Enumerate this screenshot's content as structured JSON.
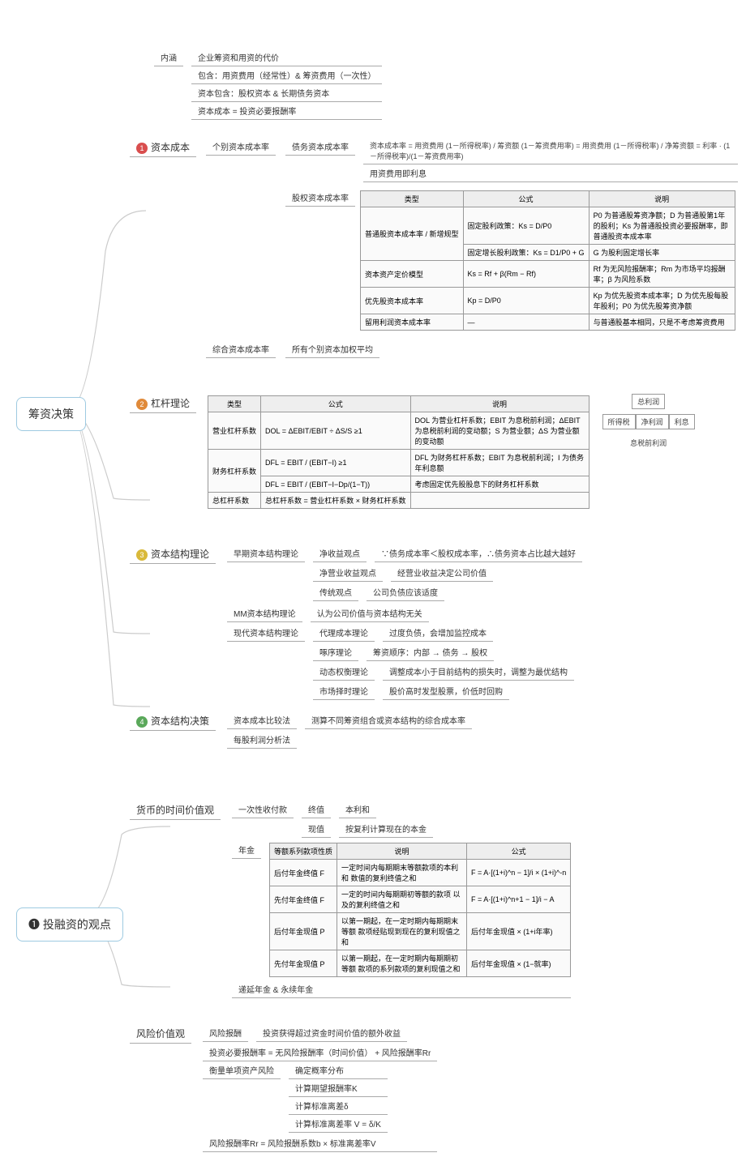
{
  "roots": {
    "r1": "筹资决策",
    "r2": "❶ 投融资的观点"
  },
  "s1": {
    "title": "资本成本",
    "conn": {
      "label": "内涵",
      "items": [
        "企业筹资和用资的代价",
        "包含：用资费用（经常性）& 筹资费用（一次性）",
        "资本包含：股权资本 & 长期债务资本",
        "资本成本 = 投资必要报酬率"
      ]
    },
    "indiv": {
      "label": "个别资本成本率",
      "debt": {
        "label": "债务资本成本率",
        "formula": "资本成本率 = 用资费用 (1－所得税率) / 筹资额 (1－筹资费用率) = 用资费用 (1－所得税率) / 净筹资额 = 利率 · (1－所得税率)/(1－筹资费用率)",
        "note": "用资费用即利息"
      },
      "equity": {
        "label": "股权资本成本率",
        "tbl": {
          "h": [
            "类型",
            "公式",
            "说明"
          ],
          "r": [
            [
              "普通股资本成本率 / 新增规型",
              "固定股利政策：Ks = D/P0",
              "P0 为普通股筹资净额；D 为普通股第1年的股利；Ks 为普通股投资必要报酬率，即普通股资本成本率"
            ],
            [
              "",
              "固定增长股利政策：Ks = D1/P0 + G",
              "G 为股利固定增长率"
            ],
            [
              "资本资产定价模型",
              "Ks = Rf + β(Rm − Rf)",
              "Rf 为无风险报酬率；Rm 为市场平均报酬率；β 为风险系数"
            ],
            [
              "优先股资本成本率",
              "Kp = D/P0",
              "Kp 为优先股资本成本率；D 为优先股每股年股利；P0 为优先股筹资净额"
            ],
            [
              "留用利润资本成本率",
              "—",
              "与普通股基本相同，只是不考虑筹资费用"
            ]
          ]
        }
      }
    },
    "comp": {
      "label": "综合资本成本率",
      "text": "所有个别资本加权平均"
    }
  },
  "s2": {
    "title": "杠杆理论",
    "tbl": {
      "h": [
        "类型",
        "公式",
        "说明"
      ],
      "r": [
        [
          "营业杠杆系数",
          "DOL = ΔEBIT/EBIT ÷ ΔS/S  ≥1",
          "DOL 为营业杠杆系数；EBIT 为息税前利润；ΔEBIT 为息税前利润的变动额；S 为营业额；ΔS 为营业额的变动额"
        ],
        [
          "财务杠杆系数",
          "DFL = EBIT / (EBIT−I)  ≥1",
          "DFL 为财务杠杆系数；EBIT 为息税前利润；I 为债务年利息额"
        ],
        [
          "",
          "DFL = EBIT / (EBIT−I−Dp/(1−T))",
          "考虑固定优先股股息下的财务杠杆系数"
        ],
        [
          "总杠杆系数",
          "总杠杆系数 = 营业杠杆系数 × 财务杠杆系数",
          ""
        ]
      ]
    },
    "side": {
      "top": "总利润",
      "row": [
        "所得税",
        "净利润",
        "利息"
      ],
      "bottom": "息税前利润"
    }
  },
  "s3": {
    "title": "资本结构理论",
    "early": {
      "label": "早期资本结构理论",
      "items": [
        {
          "k": "净收益观点",
          "v": "∵债务成本率＜股权成本率，∴债务资本占比越大越好"
        },
        {
          "k": "净营业收益观点",
          "v": "经营业收益决定公司价值"
        },
        {
          "k": "传统观点",
          "v": "公司负债应该适度"
        }
      ]
    },
    "mm": {
      "label": "MM资本结构理论",
      "text": "认为公司价值与资本结构无关"
    },
    "modern": {
      "label": "现代资本结构理论",
      "items": [
        {
          "k": "代理成本理论",
          "v": "过度负债，会增加监控成本"
        },
        {
          "k": "啄序理论",
          "v": "筹资顺序：内部 → 债务 → 股权"
        },
        {
          "k": "动态权衡理论",
          "v": "调整成本小于目前结构的损失时，调整为最优结构"
        },
        {
          "k": "市场择时理论",
          "v": "股价高时发型股票，价低时回购"
        }
      ]
    }
  },
  "s4": {
    "title": "资本结构决策",
    "items": [
      {
        "k": "资本成本比较法",
        "v": "测算不同筹资组合或资本结构的综合成本率"
      },
      {
        "k": "每股利润分析法",
        "v": ""
      }
    ]
  },
  "s5": {
    "title": "货币的时间价值观",
    "oneoff": {
      "label": "一次性收付款",
      "items": [
        {
          "k": "终值",
          "v": "本利和"
        },
        {
          "k": "现值",
          "v": "按复利计算现在的本金"
        }
      ]
    },
    "annuity": {
      "label": "年金",
      "tbl": {
        "h": [
          "等额系列款项性质",
          "说明",
          "公式"
        ],
        "r": [
          [
            "后付年金终值 F",
            "一定时间内每期期末等额款项的本利和 数值的复利终值之和",
            "F = A·[(1+i)^n − 1]/i    × (1+i)^-n"
          ],
          [
            "先付年金终值 F",
            "一定的时间内每期期初等额的款项 以及的复利终值之和",
            "F = A·[(1+i)^n+1 − 1]/i − A"
          ],
          [
            "后付年金现值 P",
            "以第一期起，在一定时期内每期期末等额 款项经贴现到现在的复利现值之和",
            "后付年金现值 × (1+i年率)"
          ],
          [
            "先付年金现值 P",
            "以第一期起，在一定时期内每期期初等额 款项的系列款项的复利现值之和",
            "后付年金现值 × (1−就率)"
          ]
        ]
      }
    },
    "defer": "递延年金 & 永续年金"
  },
  "s6": {
    "title": "风险价值观",
    "items": [
      {
        "k": "风险报酬",
        "v": "投资获得超过资金时间价值的额外收益"
      },
      {
        "k": "",
        "v": "投资必要报酬率 = 无风险报酬率（时间价值） + 风险报酬率Rr"
      }
    ],
    "measure": {
      "label": "衡量单项资产风险",
      "items": [
        "确定概率分布",
        "计算期望报酬率K",
        "计算标准离差δ",
        "计算标准离差率 V = δ/K"
      ]
    },
    "final": "风险报酬率Rr = 风险报酬系数b × 标准离差率V"
  }
}
